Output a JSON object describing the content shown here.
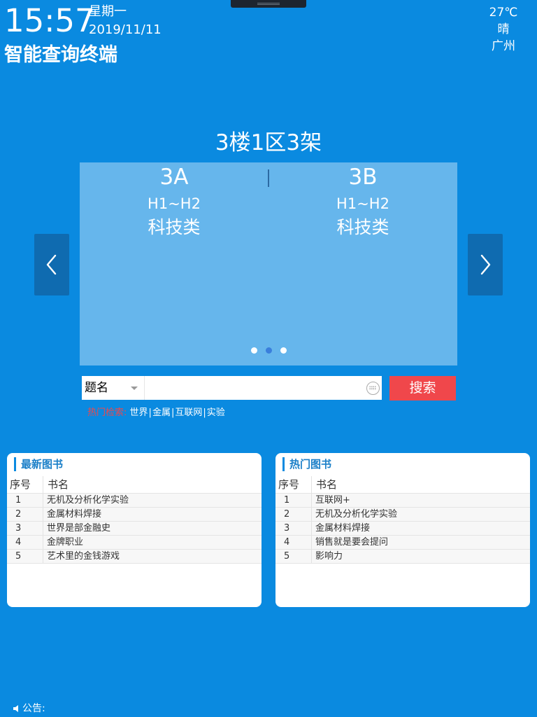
{
  "header": {
    "time": "15:57",
    "weekday": "星期一",
    "date": "2019/11/11",
    "app_title": "智能查询终端"
  },
  "weather": {
    "temperature": "27℃",
    "condition": "晴",
    "city": "广州"
  },
  "location": {
    "title": "3楼1区3架"
  },
  "carousel": {
    "active_index": 1,
    "slide_count": 3,
    "shelves": [
      {
        "code": "3A",
        "range": "H1~H2",
        "category": "科技类"
      },
      {
        "code": "3B",
        "range": "H1~H2",
        "category": "科技类"
      }
    ]
  },
  "search": {
    "type_selected": "题名",
    "input_value": "",
    "placeholder": "",
    "button_label": "搜索",
    "hot_label": "热门检索:",
    "hot_terms": [
      "世界",
      "金属",
      "互联网",
      "实验"
    ],
    "hot_separator": "|"
  },
  "latest_books": {
    "title": "最新图书",
    "col_no": "序号",
    "col_name": "书名",
    "rows": [
      {
        "no": "1",
        "name": "无机及分析化学实验"
      },
      {
        "no": "2",
        "name": "金属材料焊接"
      },
      {
        "no": "3",
        "name": "世界是部金融史"
      },
      {
        "no": "4",
        "name": "金牌职业"
      },
      {
        "no": "5",
        "name": "艺术里的金钱游戏"
      }
    ]
  },
  "hot_books": {
    "title": "热门图书",
    "col_no": "序号",
    "col_name": "书名",
    "rows": [
      {
        "no": "1",
        "name": "互联网+"
      },
      {
        "no": "2",
        "name": "无机及分析化学实验"
      },
      {
        "no": "3",
        "name": "金属材料焊接"
      },
      {
        "no": "4",
        "name": "销售就是要会提问"
      },
      {
        "no": "5",
        "name": "影响力"
      }
    ]
  },
  "notice": {
    "label": "公告:"
  },
  "colors": {
    "background": "#0a8ae0",
    "carousel": "#66b6ec",
    "nav_button": "#0f6bb0",
    "search_button": "#f0474b",
    "panel_accent": "#1a7fc8"
  },
  "icons": {
    "prev": "chevron-left-icon",
    "next": "chevron-right-icon",
    "keyboard": "keyboard-icon",
    "speaker": "speaker-icon",
    "dropdown": "caret-down-icon"
  }
}
